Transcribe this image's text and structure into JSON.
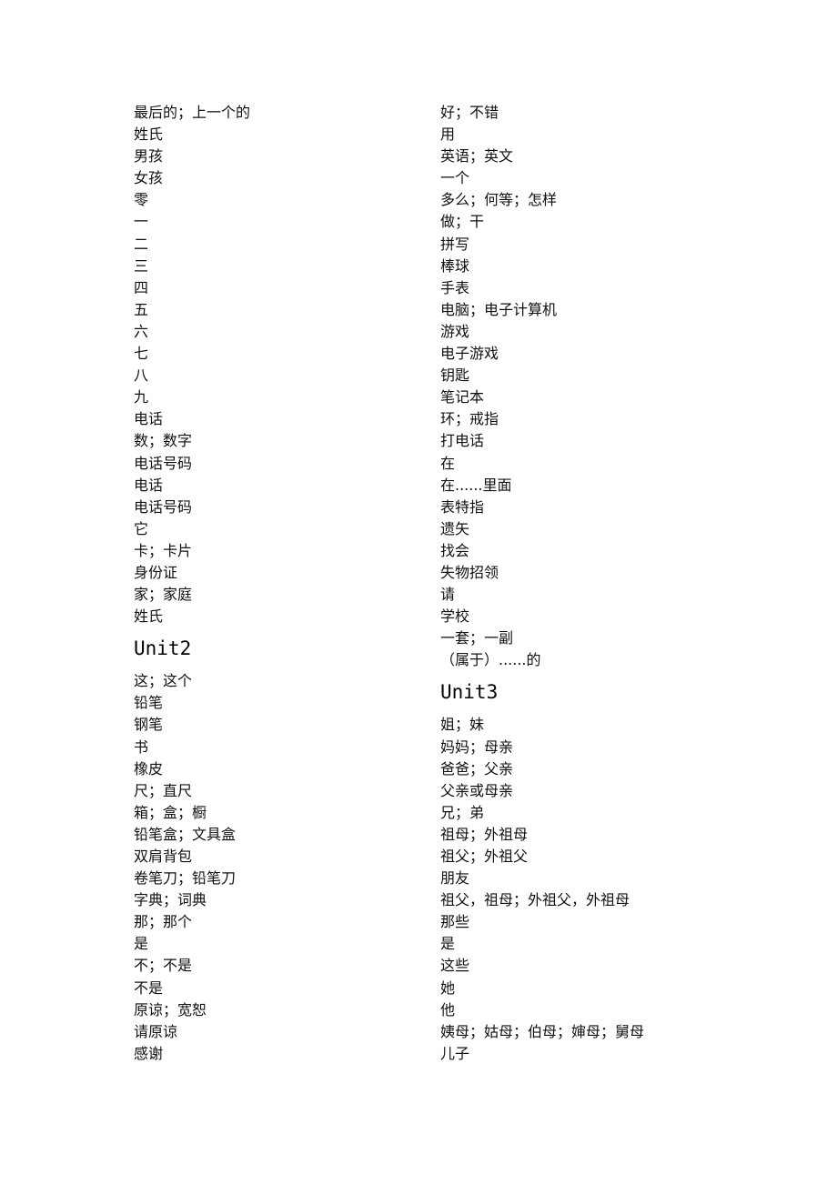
{
  "left_column": {
    "unit1_tail": [
      "最后的；上一个的",
      "姓氏",
      "男孩",
      "女孩",
      "零",
      "一",
      "二",
      "三",
      "四",
      "五",
      "六",
      "七",
      "八",
      "九",
      "电话",
      "数；数字",
      "电话号码",
      "电话",
      "电话号码",
      "它",
      "卡；卡片",
      "身份证",
      "家；家庭",
      "姓氏"
    ],
    "unit2_heading": "Unit2",
    "unit2_items": [
      "这；这个",
      "铅笔",
      "钢笔",
      "书",
      "橡皮",
      "尺；直尺",
      "箱；盒；橱",
      "铅笔盒；文具盒",
      "双肩背包",
      "卷笔刀；铅笔刀",
      "字典；词典",
      "那；那个",
      "是",
      "不；不是",
      "不是",
      "原谅；宽恕",
      "请原谅",
      "感谢"
    ]
  },
  "right_column": {
    "unit2_tail": [
      "好；不错",
      "用",
      "英语；英文",
      "一个",
      "多么；何等；怎样",
      "做；干",
      "拼写",
      "棒球",
      "手表",
      "电脑；电子计算机",
      "游戏",
      "电子游戏",
      "钥匙",
      "笔记本",
      "环；戒指",
      "打电话",
      "在",
      "在......里面",
      "表特指",
      "遗矢",
      "找会",
      "失物招领",
      "请",
      "学校",
      "一套；一副",
      "（属于）......的"
    ],
    "unit3_heading": "Unit3",
    "unit3_items": [
      "姐；妹",
      "妈妈；母亲",
      "爸爸；父亲",
      "父亲或母亲",
      "兄；弟",
      "祖母；外祖母",
      "祖父；外祖父",
      "朋友",
      "祖父，祖母；外祖父，外祖母",
      "那些",
      "是",
      "这些",
      "她",
      "他",
      "姨母；姑母；伯母；婶母；舅母",
      "儿子"
    ]
  }
}
